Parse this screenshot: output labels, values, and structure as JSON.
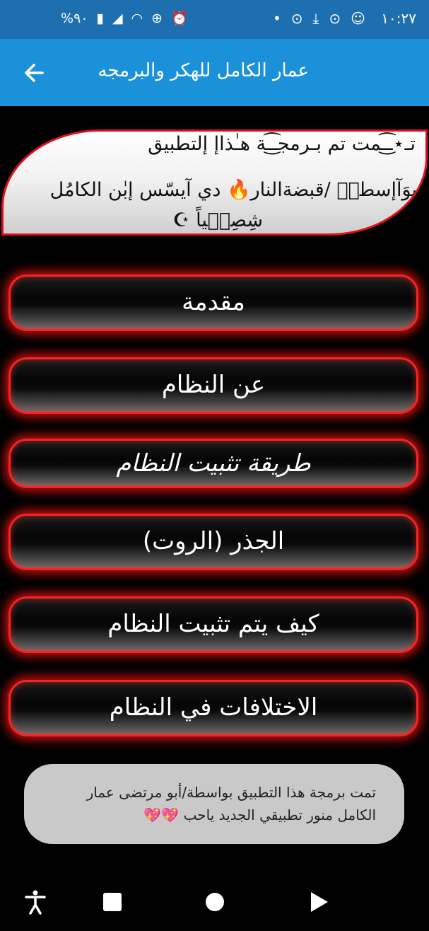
{
  "status_bar": {
    "time": "١٠:٢٧",
    "battery": "%٩٠"
  },
  "app_bar": {
    "title": "عمار الكامل للهكر والبرمجه"
  },
  "banner": {
    "line1": "تـ⋆ـ͜͡ـمت تم بـرمجـ͜͡ـة هـٰذاإ إلتطبيق",
    "line2": "بوَآإسطهۨ /قبضةالنار🔥 دي آيسّس إبٰن الكامُل",
    "line3": "شِصِخۨياً ☪︎"
  },
  "menu": [
    {
      "label": "مقدمة"
    },
    {
      "label": "عن النظام"
    },
    {
      "label": "طريقة تثبيت النظام"
    },
    {
      "label": "الجذر (الروت)"
    },
    {
      "label": "كيف يتم تثبيت النظام"
    },
    {
      "label": "الاختلافات في النظام"
    }
  ],
  "toast": {
    "line1": "تمت برمجة هذا التطبيق بواسطة/أبو مرتضى عمار",
    "line2": "الكامل منور تطبيقي الجديد ياحب 💖💖"
  },
  "colors": {
    "status_bar": "#1e6fb0",
    "app_bar": "#1a91d9",
    "button_glow": "#ff2020",
    "toast_bg": "#c9c9c9"
  }
}
